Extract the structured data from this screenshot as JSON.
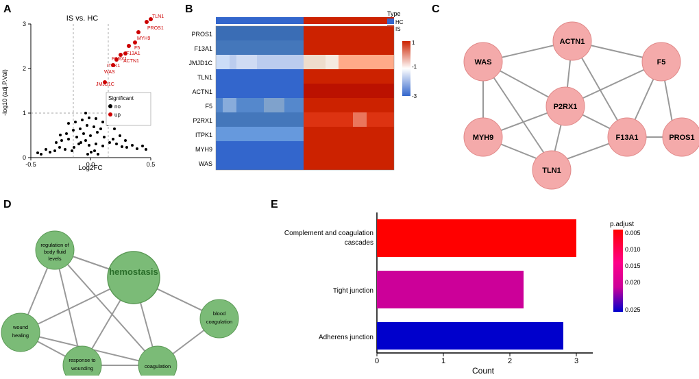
{
  "panels": {
    "a": {
      "label": "A",
      "title": "IS vs. HC",
      "xaxis": "Log2FC",
      "yaxis": "-log10 (adj.P.Val)",
      "legend": {
        "title": "Significant",
        "no": "no",
        "up": "up"
      },
      "genes": [
        "TLN1",
        "PROS1",
        "MYH9",
        "F5",
        "F13A1",
        "P2RX1",
        "ACTN1",
        "ITPK1",
        "WAS",
        "JMJD1C"
      ]
    },
    "b": {
      "label": "B",
      "genes": [
        "PROS1",
        "F13A1",
        "JMJD1C",
        "TLN1",
        "ACTN1",
        "F5",
        "P2RX1",
        "ITPK1",
        "MYH9",
        "WAS"
      ],
      "legend": {
        "type_label": "Type",
        "hc": "HC",
        "is": "IS",
        "scale_high": "1",
        "scale_mid": "-1",
        "scale_low": "-3"
      }
    },
    "c": {
      "label": "C",
      "nodes": [
        "WAS",
        "ACTN1",
        "F5",
        "P2RX1",
        "MYH9",
        "TLN1",
        "F13A1",
        "PROS1"
      ]
    },
    "d": {
      "label": "D",
      "nodes": [
        "hemostasis",
        "regulation of body fluid levels",
        "wound healing",
        "response to wounding",
        "coagulation",
        "blood coagulation"
      ],
      "center": "hemostasis"
    },
    "e": {
      "label": "E",
      "bars": [
        {
          "label": "Complement and coagulation\ncascades",
          "count": 3,
          "color": "#FF0000"
        },
        {
          "label": "Tight junction",
          "count": 2.2,
          "color": "#CC00AA"
        },
        {
          "label": "Adherens junction",
          "count": 2.8,
          "color": "#0000CC"
        }
      ],
      "xaxis": "Count",
      "legend": {
        "title": "p.adjust",
        "v1": "0.005",
        "v2": "0.010",
        "v3": "0.015",
        "v4": "0.020",
        "v5": "0.025"
      },
      "xticks": [
        "0",
        "1",
        "2",
        "3"
      ]
    }
  }
}
